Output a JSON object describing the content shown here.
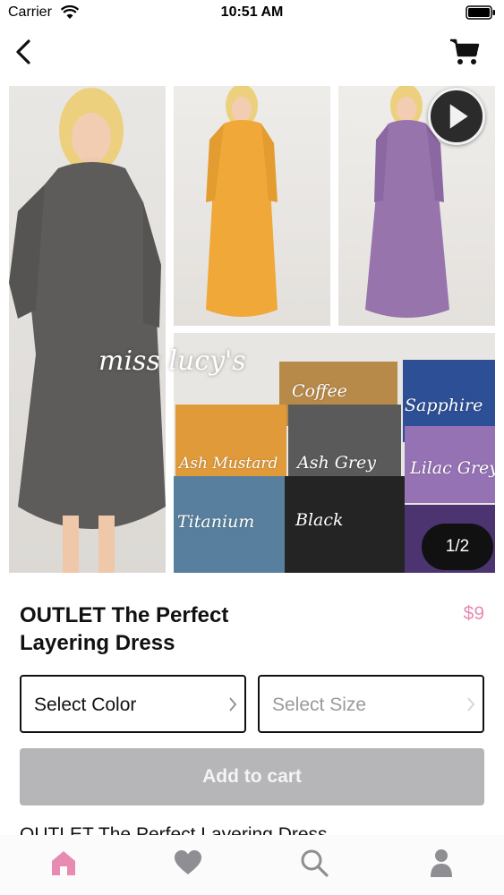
{
  "status_bar": {
    "carrier": "Carrier",
    "time": "10:51 AM"
  },
  "nav": {
    "back_icon": "chevron-left-icon",
    "cart_icon": "shopping-cart-icon"
  },
  "gallery": {
    "watermark": "miss lucy's",
    "page_indicator": "1/2",
    "play_icon": "play-icon",
    "swatches": [
      {
        "label": "Coffee",
        "color": "#b88a4a"
      },
      {
        "label": "Sapphire",
        "color": "#2c4f96"
      },
      {
        "label": "Ash Mustard",
        "color": "#e09a3a"
      },
      {
        "label": "Ash Grey",
        "color": "#5a5a5a"
      },
      {
        "label": "Lilac Grey",
        "color": "#9572b4"
      },
      {
        "label": "Titanium",
        "color": "#58809e"
      },
      {
        "label": "Black",
        "color": "#242424"
      }
    ]
  },
  "product": {
    "title": "OUTLET The Perfect Layering Dress",
    "price": "$9",
    "description": "OUTLET The Perfect Layering Dress"
  },
  "selectors": {
    "color_label": "Select Color",
    "size_label": "Select Size"
  },
  "actions": {
    "add_to_cart": "Add to cart"
  },
  "tab_bar": {
    "items": [
      {
        "icon": "home-icon",
        "active": true
      },
      {
        "icon": "heart-icon",
        "active": false
      },
      {
        "icon": "search-icon",
        "active": false
      },
      {
        "icon": "profile-icon",
        "active": false
      }
    ],
    "active_color": "#e78bb3",
    "inactive_color": "#8e8e93"
  },
  "colors": {
    "accent": "#e78bb3",
    "button_disabled": "#b6b6b9"
  }
}
